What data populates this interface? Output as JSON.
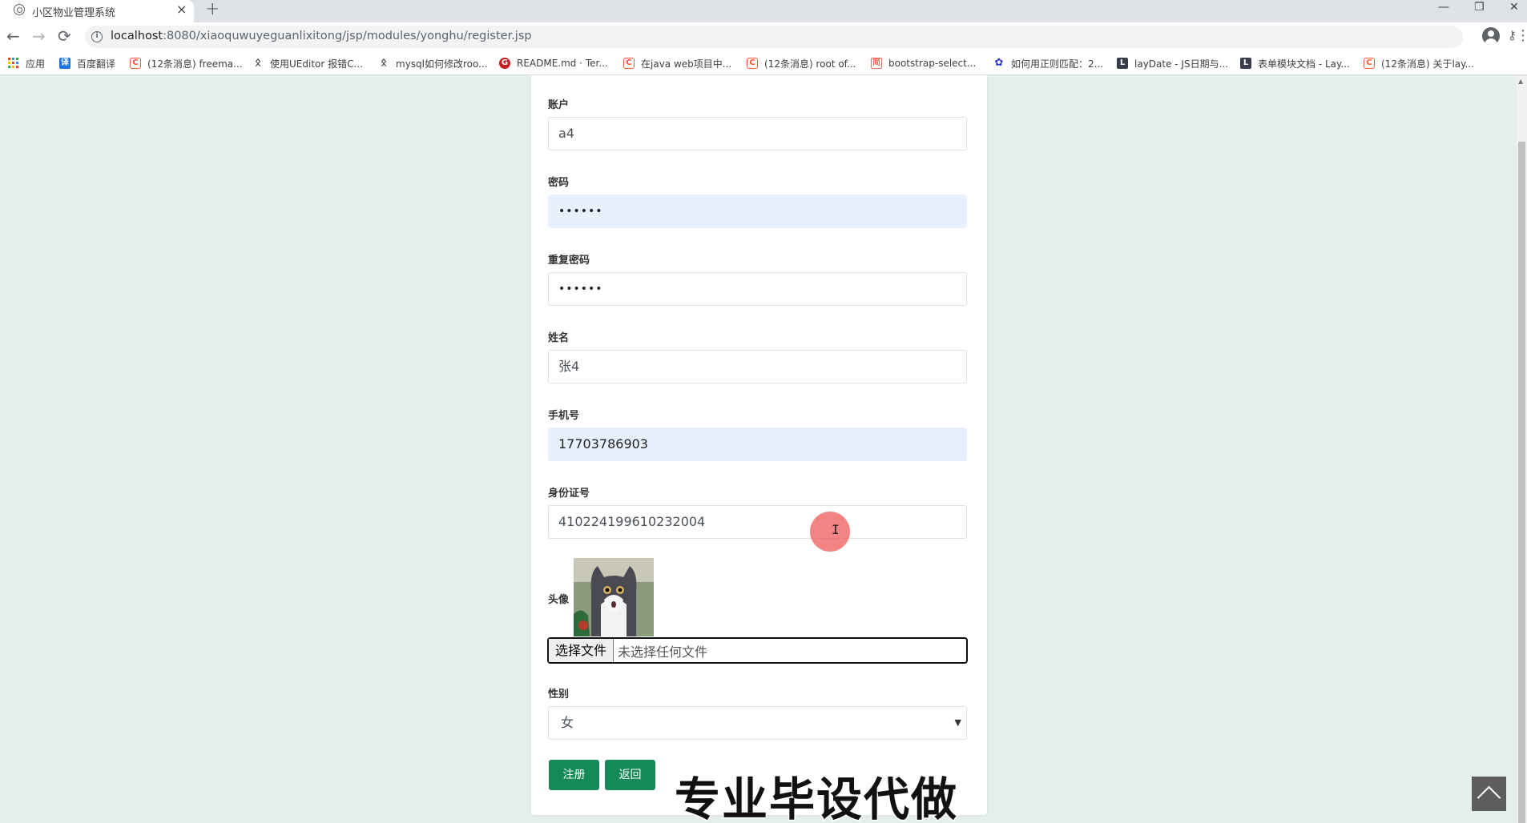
{
  "browser": {
    "tab_title": "小区物业管理系统",
    "tab_close": "×",
    "new_tab": "+",
    "url_host": "localhost",
    "url_path": ":8080/xiaoquwuyeguanlixitong/jsp/modules/yonghu/register.jsp",
    "window_controls": {
      "minimize": "—",
      "restore": "❐",
      "close": "✕"
    },
    "nav": {
      "back": "←",
      "forward": "→",
      "reload": "⟳"
    },
    "bookmarks": [
      {
        "label": "应用",
        "icon": "apps-grid-icon"
      },
      {
        "label": "百度翻译",
        "icon": "baidu-translate-icon"
      },
      {
        "label": "(12条消息) freema...",
        "icon": "csdn-icon"
      },
      {
        "label": "使用UEditor 报错C...",
        "icon": "fish-icon"
      },
      {
        "label": "mysql如何修改roo...",
        "icon": "fish-icon"
      },
      {
        "label": "README.md · Ter...",
        "icon": "gitee-icon"
      },
      {
        "label": "在java web项目中...",
        "icon": "csdn-icon"
      },
      {
        "label": "(12条消息) root of...",
        "icon": "csdn-icon"
      },
      {
        "label": "bootstrap-select...",
        "icon": "jianshu-icon"
      },
      {
        "label": "如何用正则匹配：2...",
        "icon": "baidu-paw-icon"
      },
      {
        "label": "layDate - JS日期与...",
        "icon": "layui-icon"
      },
      {
        "label": "表单模块文档 - Lay...",
        "icon": "layui-icon"
      },
      {
        "label": "(12条消息) 关于lay...",
        "icon": "csdn-icon"
      }
    ]
  },
  "form": {
    "account": {
      "label": "账户",
      "value": "a4"
    },
    "password": {
      "label": "密码",
      "value": "••••••"
    },
    "password_repeat": {
      "label": "重复密码",
      "value": "••••••"
    },
    "name": {
      "label": "姓名",
      "value": "张4"
    },
    "phone": {
      "label": "手机号",
      "value": "17703786903"
    },
    "id_card": {
      "label": "身份证号",
      "value": "410224199610232004"
    },
    "avatar": {
      "label": "头像",
      "file_button": "选择文件",
      "file_status": "未选择任何文件"
    },
    "gender": {
      "label": "性别",
      "value": "女"
    },
    "register_button": "注册",
    "back_button": "返回"
  },
  "overlay": {
    "watermark": "专业毕设代做",
    "cursor": "I"
  },
  "colors": {
    "page_bg": "#e4efe9",
    "button_green": "#158956",
    "autofill_bg": "#e8f0fe"
  }
}
